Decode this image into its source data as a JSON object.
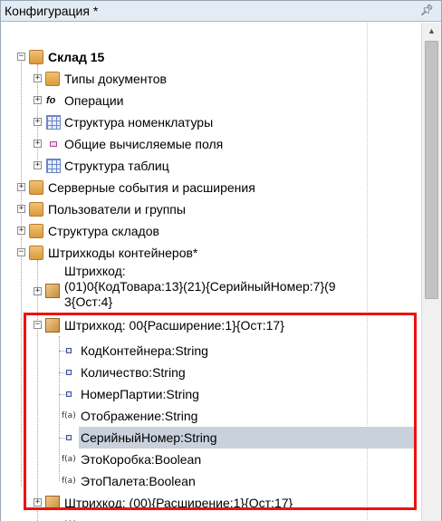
{
  "panel": {
    "title": "Конфигурация *",
    "pin_icon": "pin-icon"
  },
  "tree": {
    "root": {
      "label": "Склад 15"
    },
    "items": [
      {
        "label": "Типы документов",
        "icon": "doc-types-icon"
      },
      {
        "label": "Операции",
        "icon": "operations-icon"
      },
      {
        "label": "Структура номенклатуры",
        "icon": "grid-icon"
      },
      {
        "label": "Общие вычисляемые поля",
        "icon": "calc-fields-icon"
      },
      {
        "label": "Структура таблиц",
        "icon": "table-structure-icon"
      },
      {
        "label": "Серверные события и расширения",
        "icon": "server-events-icon"
      },
      {
        "label": "Пользователи и группы",
        "icon": "users-icon"
      },
      {
        "label": "Структура складов",
        "icon": "warehouse-icon"
      },
      {
        "label": "Штрихкоды контейнеров*",
        "icon": "barcodes-icon"
      }
    ],
    "barcode1": {
      "line1": "Штрихкод:",
      "line2": "(01)0{КодТовара:13}(21){СерийныйНомер:7}(9",
      "line3": "3{Ост:4}"
    },
    "barcode2": {
      "label": "Штрихкод: 00{Расширение:1}{Ост:17}",
      "fields": [
        {
          "label": "КодКонтейнера:String",
          "icon": "field-icon"
        },
        {
          "label": "Количество:String",
          "icon": "field-icon"
        },
        {
          "label": "НомерПартии:String",
          "icon": "field-icon"
        },
        {
          "label": "Отображение:String",
          "icon": "fx-icon",
          "fx": "f(a)"
        },
        {
          "label": "СерийныйНомер:String",
          "icon": "field-icon"
        },
        {
          "label": "ЭтоКоробка:Boolean",
          "icon": "fx-icon",
          "fx": "f(a)",
          "selected": true
        },
        {
          "label": "ЭтоПалета:Boolean",
          "icon": "fx-icon",
          "fx": "f(a)"
        }
      ]
    },
    "barcode3": {
      "label": "Штрихкод: (00){Расширение:1}{Ост:17}"
    },
    "barcode4": {
      "label": "Штрихкод:"
    }
  },
  "colors": {
    "highlight_border": "#ee1111",
    "selection_bg": "#c9d1dc",
    "titlebar_bg": "#e3ebf5"
  }
}
